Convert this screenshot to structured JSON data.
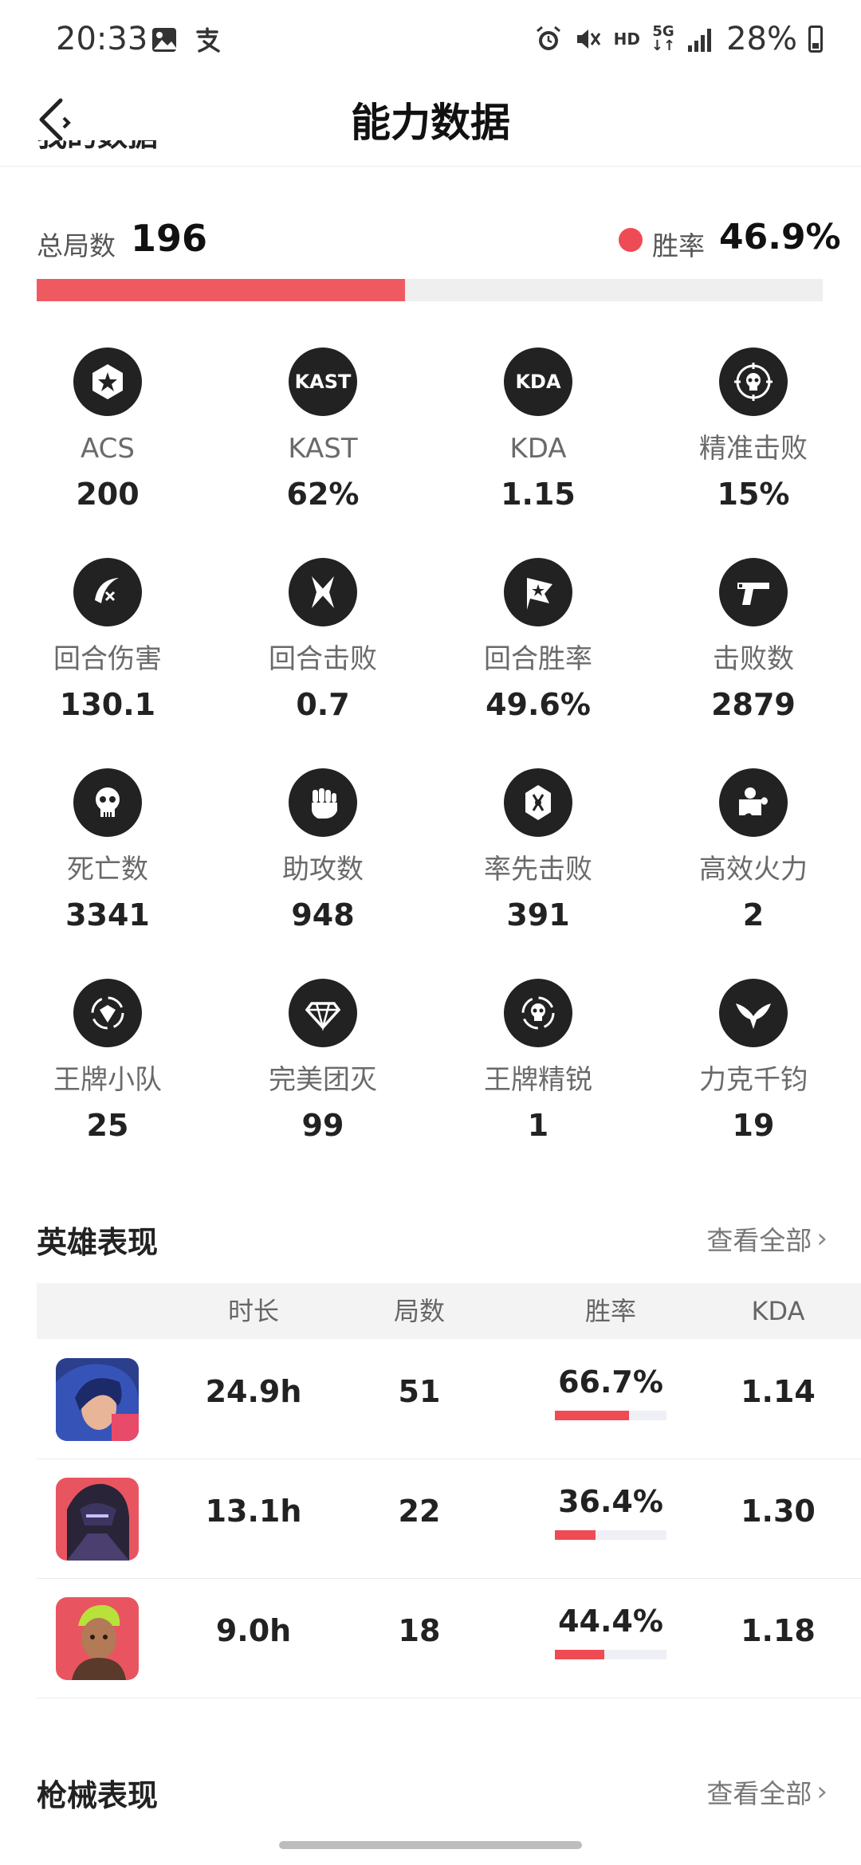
{
  "status_bar": {
    "time": "20:33",
    "left_icons": [
      "gallery-icon",
      "alipay-icon"
    ],
    "right_icons": [
      "alarm-icon",
      "mute-icon"
    ],
    "hd": "HD",
    "network": "5G",
    "battery_pct": "28%",
    "battery_level": 0.28
  },
  "header": {
    "title": "能力数据"
  },
  "partial_section_title": "我的数据",
  "summary": {
    "total_label": "总局数",
    "total_value": "196",
    "winrate_label": "胜率",
    "winrate_value": "46.9%",
    "winrate_fraction": 0.469,
    "accent_color": "#ef4b55"
  },
  "stats": [
    {
      "icon": "star-hexagon-icon",
      "icon_text": "",
      "label": "ACS",
      "value": "200"
    },
    {
      "icon": "kast-icon",
      "icon_text": "KAST",
      "label": "KAST",
      "value": "62%"
    },
    {
      "icon": "kda-icon",
      "icon_text": "KDA",
      "label": "KDA",
      "value": "1.15"
    },
    {
      "icon": "crosshair-skull-icon",
      "icon_text": "",
      "label": "精准击败",
      "value": "15%"
    },
    {
      "icon": "slash-damage-icon",
      "icon_text": "",
      "label": "回合伤害",
      "value": "130.1"
    },
    {
      "icon": "crossed-blades-icon",
      "icon_text": "",
      "label": "回合击败",
      "value": "0.7"
    },
    {
      "icon": "flag-icon",
      "icon_text": "",
      "label": "回合胜率",
      "value": "49.6%"
    },
    {
      "icon": "pistol-icon",
      "icon_text": "",
      "label": "击败数",
      "value": "2879"
    },
    {
      "icon": "skull-icon",
      "icon_text": "",
      "label": "死亡数",
      "value": "3341"
    },
    {
      "icon": "fist-icon",
      "icon_text": "",
      "label": "助攻数",
      "value": "948"
    },
    {
      "icon": "first-blood-icon",
      "icon_text": "",
      "label": "率先击败",
      "value": "391"
    },
    {
      "icon": "puzzle-firepower-icon",
      "icon_text": "",
      "label": "高效火力",
      "value": "2"
    },
    {
      "icon": "ace-squad-icon",
      "icon_text": "",
      "label": "王牌小队",
      "value": "25"
    },
    {
      "icon": "diamond-icon",
      "icon_text": "",
      "label": "完美团灭",
      "value": "99"
    },
    {
      "icon": "elite-skull-icon",
      "icon_text": "",
      "label": "王牌精锐",
      "value": "1"
    },
    {
      "icon": "wings-icon",
      "icon_text": "",
      "label": "力克千钧",
      "value": "19"
    }
  ],
  "heroes_section": {
    "title": "英雄表现",
    "view_all": "查看全部",
    "columns": [
      "时长",
      "局数",
      "胜率",
      "KDA"
    ],
    "rows": [
      {
        "avatar": "hero-avatar-1",
        "duration": "24.9h",
        "games": "51",
        "winrate": "66.7%",
        "winrate_fraction": 0.667,
        "kda": "1.14"
      },
      {
        "avatar": "hero-avatar-2",
        "duration": "13.1h",
        "games": "22",
        "winrate": "36.4%",
        "winrate_fraction": 0.364,
        "kda": "1.30"
      },
      {
        "avatar": "hero-avatar-3",
        "duration": "9.0h",
        "games": "18",
        "winrate": "44.4%",
        "winrate_fraction": 0.444,
        "kda": "1.18"
      }
    ]
  },
  "weapons_section": {
    "title": "枪械表现",
    "view_all": "查看全部"
  }
}
